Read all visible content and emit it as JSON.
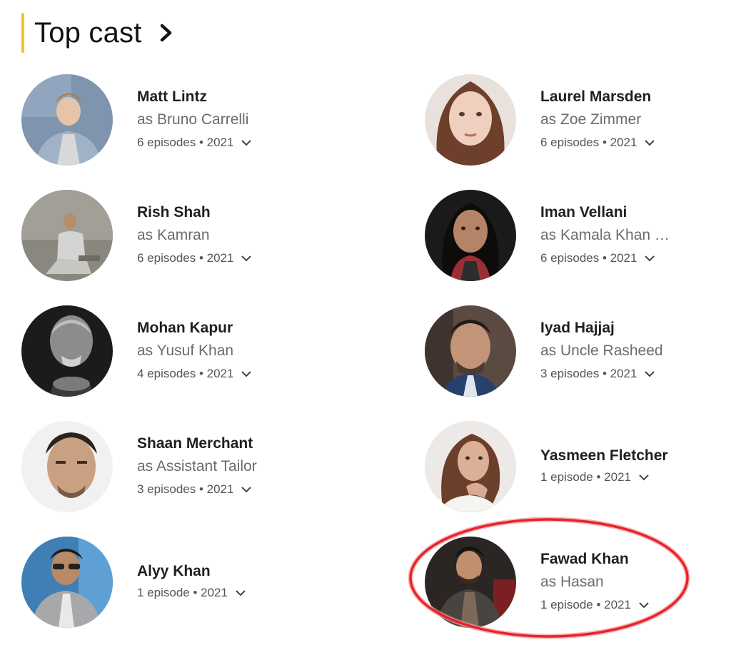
{
  "section": {
    "title": "Top cast",
    "accent_color": "#f5c518",
    "chevron_icon": "chevron-right-icon"
  },
  "cast": [
    {
      "name": "Matt Lintz",
      "character": "as Bruno Carrelli",
      "episodes": "6 episodes • 2021"
    },
    {
      "name": "Laurel Marsden",
      "character": "as Zoe Zimmer",
      "episodes": "6 episodes • 2021"
    },
    {
      "name": "Rish Shah",
      "character": "as Kamran",
      "episodes": "6 episodes • 2021"
    },
    {
      "name": "Iman Vellani",
      "character": "as Kamala Khan  …",
      "episodes": "6 episodes • 2021"
    },
    {
      "name": "Mohan Kapur",
      "character": "as Yusuf Khan",
      "episodes": "4 episodes • 2021"
    },
    {
      "name": "Iyad Hajjaj",
      "character": "as Uncle Rasheed",
      "episodes": "3 episodes • 2021"
    },
    {
      "name": "Shaan Merchant",
      "character": "as Assistant Tailor",
      "episodes": "3 episodes • 2021"
    },
    {
      "name": "Yasmeen Fletcher",
      "character": "",
      "episodes": "1 episode • 2021"
    },
    {
      "name": "Alyy Khan",
      "character": "",
      "episodes": "1 episode • 2021"
    },
    {
      "name": "Fawad Khan",
      "character": "as Hasan",
      "episodes": "1 episode • 2021"
    }
  ],
  "highlight": {
    "color": "#e8232b",
    "target": "Fawad Khan"
  }
}
